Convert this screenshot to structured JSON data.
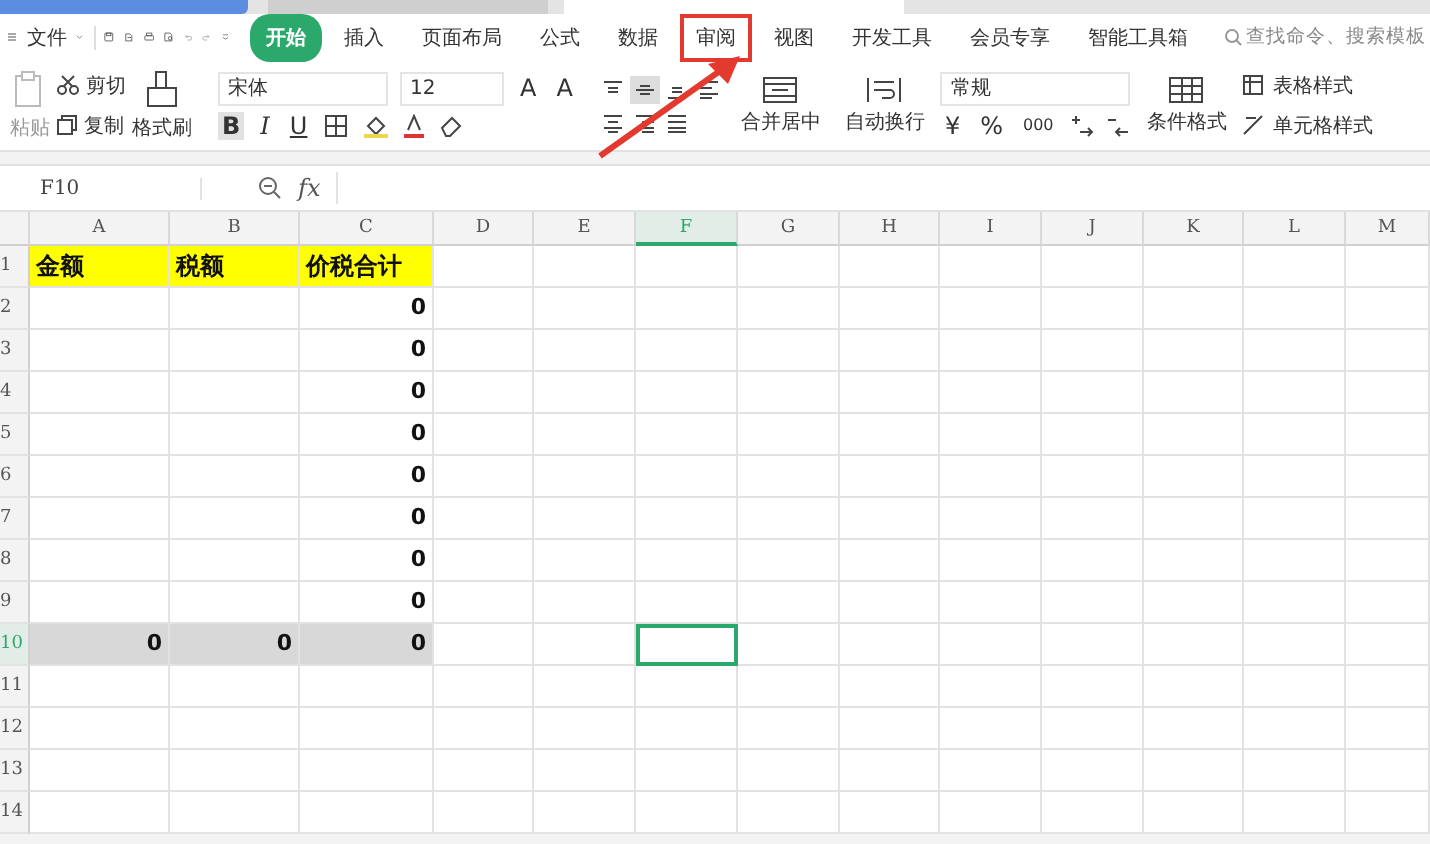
{
  "menu": {
    "file_label": "文件"
  },
  "tabs": [
    {
      "label": "开始",
      "selected": true,
      "highlighted": false
    },
    {
      "label": "插入",
      "selected": false,
      "highlighted": false
    },
    {
      "label": "页面布局",
      "selected": false,
      "highlighted": false
    },
    {
      "label": "公式",
      "selected": false,
      "highlighted": false
    },
    {
      "label": "数据",
      "selected": false,
      "highlighted": false
    },
    {
      "label": "审阅",
      "selected": false,
      "highlighted": true
    },
    {
      "label": "视图",
      "selected": false,
      "highlighted": false
    },
    {
      "label": "开发工具",
      "selected": false,
      "highlighted": false
    },
    {
      "label": "会员专享",
      "selected": false,
      "highlighted": false
    },
    {
      "label": "智能工具箱",
      "selected": false,
      "highlighted": false
    }
  ],
  "search": {
    "placeholder": "查找命令、搜索模板"
  },
  "ribbon": {
    "paste": "粘贴",
    "cut": "剪切",
    "copy": "复制",
    "format_painter": "格式刷",
    "font": "宋体",
    "font_size": "12",
    "grow_font": "A",
    "shrink_font": "A",
    "bold": "B",
    "italic": "I",
    "underline": "U",
    "merge": "合并居中",
    "wrap": "自动换行",
    "number_format": "常规",
    "currency": "¥",
    "percent": "%",
    "thousands": "000",
    "conditional_format": "条件格式",
    "table_style": "表格样式",
    "cell_style": "单元格样式"
  },
  "formula_bar": {
    "cell_ref": "F10",
    "fx": "fx"
  },
  "sheet": {
    "columns": [
      {
        "label": "A",
        "selected": false
      },
      {
        "label": "B",
        "selected": false
      },
      {
        "label": "C",
        "selected": false
      },
      {
        "label": "D",
        "selected": false
      },
      {
        "label": "E",
        "selected": false
      },
      {
        "label": "F",
        "selected": true
      },
      {
        "label": "G",
        "selected": false
      },
      {
        "label": "H",
        "selected": false
      },
      {
        "label": "I",
        "selected": false
      },
      {
        "label": "J",
        "selected": false
      },
      {
        "label": "K",
        "selected": false
      },
      {
        "label": "L",
        "selected": false
      },
      {
        "label": "M",
        "selected": false
      }
    ],
    "rows": [
      {
        "label": "1",
        "selected": false,
        "kind": "header",
        "cells": [
          "金额",
          "税额",
          "价税合计"
        ]
      },
      {
        "label": "2",
        "selected": false,
        "kind": "plain",
        "cells": [
          "",
          "",
          "0"
        ]
      },
      {
        "label": "3",
        "selected": false,
        "kind": "plain",
        "cells": [
          "",
          "",
          "0"
        ]
      },
      {
        "label": "4",
        "selected": false,
        "kind": "plain",
        "cells": [
          "",
          "",
          "0"
        ]
      },
      {
        "label": "5",
        "selected": false,
        "kind": "plain",
        "cells": [
          "",
          "",
          "0"
        ]
      },
      {
        "label": "6",
        "selected": false,
        "kind": "plain",
        "cells": [
          "",
          "",
          "0"
        ]
      },
      {
        "label": "7",
        "selected": false,
        "kind": "plain",
        "cells": [
          "",
          "",
          "0"
        ]
      },
      {
        "label": "8",
        "selected": false,
        "kind": "plain",
        "cells": [
          "",
          "",
          "0"
        ]
      },
      {
        "label": "9",
        "selected": false,
        "kind": "plain",
        "cells": [
          "",
          "",
          "0"
        ]
      },
      {
        "label": "10",
        "selected": true,
        "kind": "total",
        "cells": [
          "0",
          "0",
          "0"
        ]
      },
      {
        "label": "11",
        "selected": false,
        "kind": "plain",
        "cells": []
      },
      {
        "label": "12",
        "selected": false,
        "kind": "plain",
        "cells": []
      },
      {
        "label": "13",
        "selected": false,
        "kind": "plain",
        "cells": []
      },
      {
        "label": "14",
        "selected": false,
        "kind": "plain",
        "cells": []
      }
    ]
  }
}
